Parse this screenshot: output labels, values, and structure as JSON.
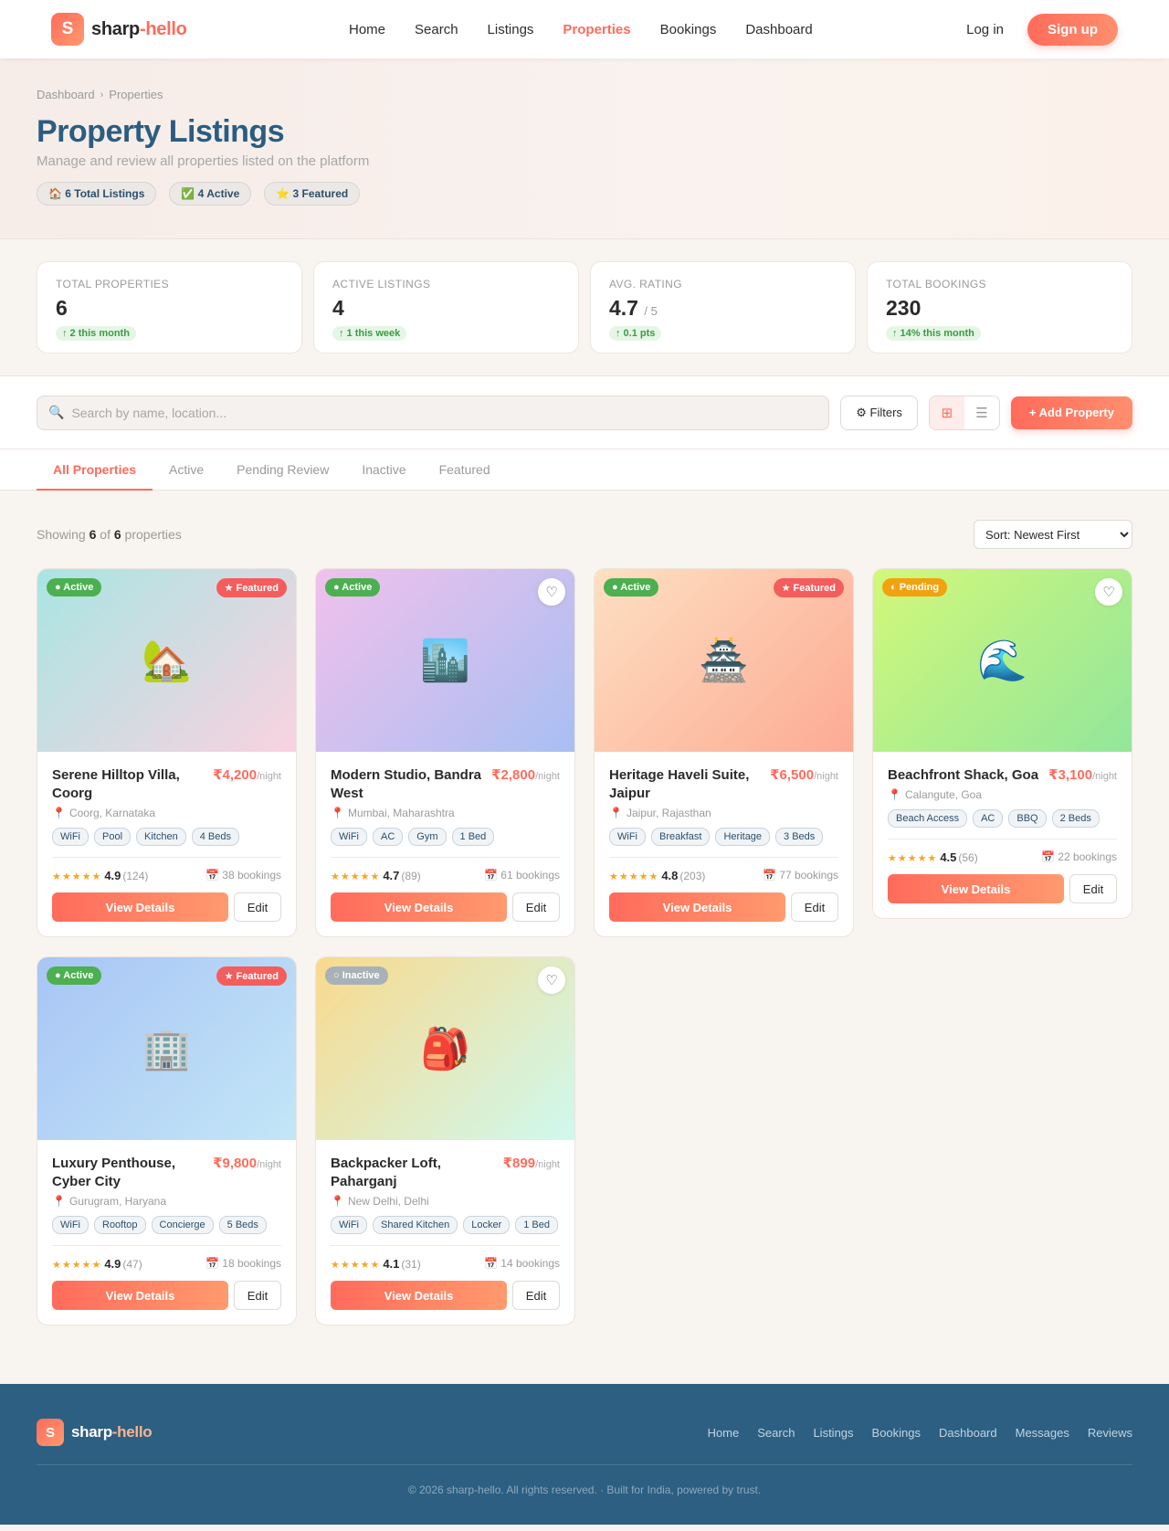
{
  "brand": {
    "name_main": "sharp",
    "name_accent": "-hello",
    "logo_letter": "S"
  },
  "nav": [
    "Home",
    "Search",
    "Listings",
    "Properties",
    "Bookings",
    "Dashboard"
  ],
  "nav_active": "Properties",
  "auth": {
    "login": "Log in",
    "signup": "Sign up"
  },
  "breadcrumb": {
    "items": [
      "Dashboard",
      "Properties"
    ],
    "separator": "›"
  },
  "hero": {
    "title": "Property Listings",
    "subtitle": "Manage and review all properties listed on the platform",
    "chips": [
      "🏠 6 Total Listings",
      "✅ 4 Active",
      "⭐ 3 Featured"
    ]
  },
  "stats": [
    {
      "label": "Total Properties",
      "value": "6",
      "suffix": "",
      "trend": "↑ 2 this month"
    },
    {
      "label": "Active Listings",
      "value": "4",
      "suffix": "",
      "trend": "↑ 1 this week"
    },
    {
      "label": "Avg. Rating",
      "value": "4.7",
      "suffix": "/ 5",
      "trend": "↑ 0.1 pts"
    },
    {
      "label": "Total Bookings",
      "value": "230",
      "suffix": "",
      "trend": "↑ 14% this month"
    }
  ],
  "toolbar": {
    "search_placeholder": "Search by name, location...",
    "search_icon": "🔍",
    "filters_label": "⚙ Filters",
    "grid_icon": "⊞",
    "list_icon": "☰",
    "add_label": "+ Add Property"
  },
  "tabs": [
    "All Properties",
    "Active",
    "Pending Review",
    "Inactive",
    "Featured"
  ],
  "tab_active": "All Properties",
  "listing": {
    "showing_prefix": "Showing",
    "shown": "6",
    "of": "of",
    "total": "6",
    "suffix": "properties",
    "sort_label": "Sort: Newest First"
  },
  "card_labels": {
    "price_unit": "/night",
    "view_details": "View Details",
    "edit": "Edit",
    "stars": "★★★★★",
    "pin": "📍",
    "heart": "♡",
    "bookings_icon": "📅"
  },
  "properties": [
    {
      "title": "Serene Hilltop Villa, Coorg",
      "price": "₹4,200",
      "location": "Coorg, Karnataka",
      "amenities": [
        "WiFi",
        "Pool",
        "Kitchen",
        "4 Beds"
      ],
      "rating": "4.9",
      "reviews": "(124)",
      "bookings": "38 bookings",
      "status": "● Active",
      "status_color": "#4caf50",
      "featured": "★ Featured",
      "emoji": "🏡",
      "gradient": [
        "#a9e5e3",
        "#f9d2e0"
      ]
    },
    {
      "title": "Modern Studio, Bandra West",
      "price": "₹2,800",
      "location": "Mumbai, Maharashtra",
      "amenities": [
        "WiFi",
        "AC",
        "Gym",
        "1 Bed"
      ],
      "rating": "4.7",
      "reviews": "(89)",
      "bookings": "61 bookings",
      "status": "● Active",
      "status_color": "#4caf50",
      "featured": "",
      "emoji": "🏙️",
      "gradient": [
        "#f1c0ec",
        "#a8bff2"
      ]
    },
    {
      "title": "Heritage Haveli Suite, Jaipur",
      "price": "₹6,500",
      "location": "Jaipur, Rajasthan",
      "amenities": [
        "WiFi",
        "Breakfast",
        "Heritage",
        "3 Beds"
      ],
      "rating": "4.8",
      "reviews": "(203)",
      "bookings": "77 bookings",
      "status": "● Active",
      "status_color": "#4caf50",
      "featured": "★ Featured",
      "emoji": "🏯",
      "gradient": [
        "#fde0c2",
        "#fdaa94"
      ]
    },
    {
      "title": "Beachfront Shack, Goa",
      "price": "₹3,100",
      "location": "Calangute, Goa",
      "amenities": [
        "Beach Access",
        "AC",
        "BBQ",
        "2 Beds"
      ],
      "rating": "4.5",
      "reviews": "(56)",
      "bookings": "22 bookings",
      "status": "◐ Pending",
      "status_color": "#f2a20f",
      "featured": "",
      "emoji": "🌊",
      "gradient": [
        "#d2f87a",
        "#92e69b"
      ]
    },
    {
      "title": "Luxury Penthouse, Cyber City",
      "price": "₹9,800",
      "location": "Gurugram, Haryana",
      "amenities": [
        "WiFi",
        "Rooftop",
        "Concierge",
        "5 Beds"
      ],
      "rating": "4.9",
      "reviews": "(47)",
      "bookings": "18 bookings",
      "status": "● Active",
      "status_color": "#4caf50",
      "featured": "★ Featured",
      "emoji": "🏢",
      "gradient": [
        "#a8c5f5",
        "#c3e6f7"
      ]
    },
    {
      "title": "Backpacker Loft, Paharganj",
      "price": "₹899",
      "location": "New Delhi, Delhi",
      "amenities": [
        "WiFi",
        "Shared Kitchen",
        "Locker",
        "1 Bed"
      ],
      "rating": "4.1",
      "reviews": "(31)",
      "bookings": "14 bookings",
      "status": "○ Inactive",
      "status_color": "#a9b1b8",
      "featured": "",
      "emoji": "🎒",
      "gradient": [
        "#f9d98c",
        "#cff9ef"
      ]
    }
  ],
  "footer": {
    "links": [
      "Home",
      "Search",
      "Listings",
      "Bookings",
      "Dashboard",
      "Messages",
      "Reviews"
    ],
    "copyright": "© 2026 sharp-hello. All rights reserved. · Built for India, powered by trust."
  }
}
